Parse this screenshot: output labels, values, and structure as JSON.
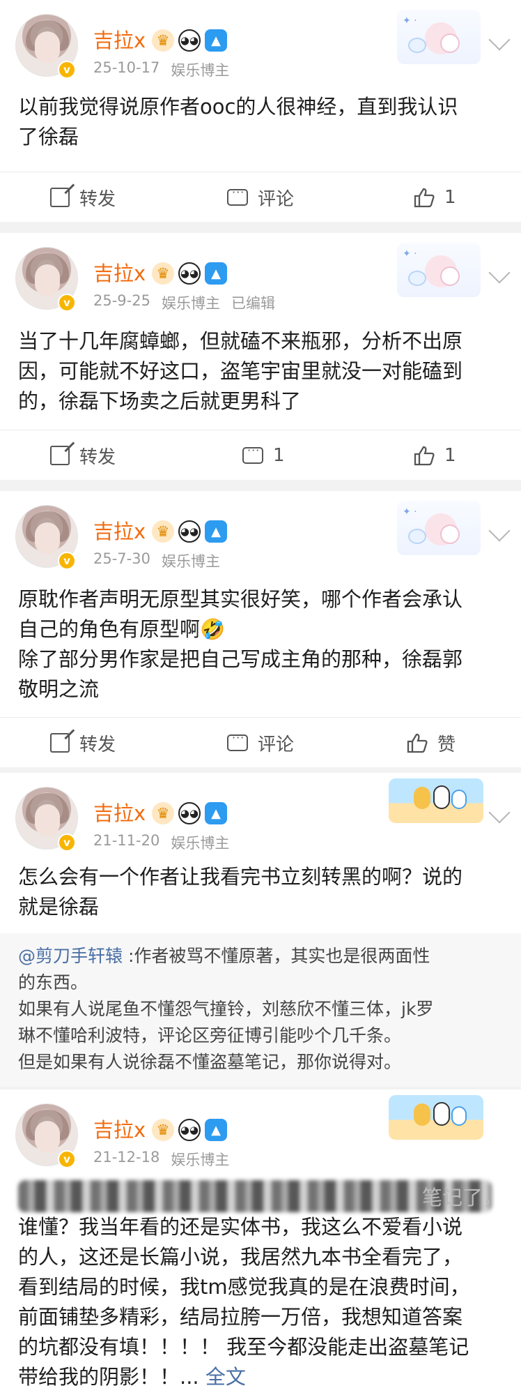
{
  "posts": [
    {
      "name": "吉拉x",
      "date": "25-10-17",
      "role": "娱乐博主",
      "edited": "",
      "text": "以前我觉得说原作者ooc的人很神经，直到我认识\n了徐磊",
      "repost_label": "转发",
      "comment_label": "评论",
      "like_label": "1"
    },
    {
      "name": "吉拉x",
      "date": "25-9-25",
      "role": "娱乐博主",
      "edited": "已编辑",
      "text": "当了十几年腐蟑螂，但就磕不来瓶邪，分析不出原\n因，可能就不好这口，盗笔宇宙里就没一对能磕到\n的，徐磊下场卖之后就更男科了",
      "repost_label": "转发",
      "comment_label": "1",
      "like_label": "1"
    },
    {
      "name": "吉拉x",
      "date": "25-7-30",
      "role": "娱乐博主",
      "edited": "",
      "text": "原耽作者声明无原型其实很好笑，哪个作者会承认\n自己的角色有原型啊🤣\n除了部分男作家是把自己写成主角的那种，徐磊郭\n敬明之流",
      "repost_label": "转发",
      "comment_label": "评论",
      "like_label": "赞"
    },
    {
      "name": "吉拉x",
      "date": "21-11-20",
      "role": "娱乐博主",
      "edited": "",
      "text": "怎么会有一个作者让我看完书立刻转黑的啊？说的\n就是徐磊",
      "repost": {
        "author": "@剪刀手轩辕",
        "text": " :作者被骂不懂原著，其实也是很两面性\n的东西。\n如果有人说尾鱼不懂怨气撞铃，刘慈欣不懂三体，jk罗\n琳不懂哈利波特，评论区旁征博引能吵个几千条。\n但是如果有人说徐磊不懂盗墓笔记，那你说得对。"
      }
    },
    {
      "name": "吉拉x",
      "date": "21-12-18",
      "role": "娱乐博主",
      "edited": "",
      "blurred_tail": "笔记了，",
      "text": "谁懂？我当年看的还是实体书，我这么不爱看小说\n的人，这还是长篇小说，我居然九本书全看完了，\n看到结局的时候，我tm感觉我真的是在浪费时间，\n前面铺垫多精彩，结局拉胯一万倍，我想知道答案\n的坑都没有填！！！！ 我至今都没能走出盗墓笔记\n带给我的阴影！！... ",
      "full_text_label": "全文"
    }
  ]
}
